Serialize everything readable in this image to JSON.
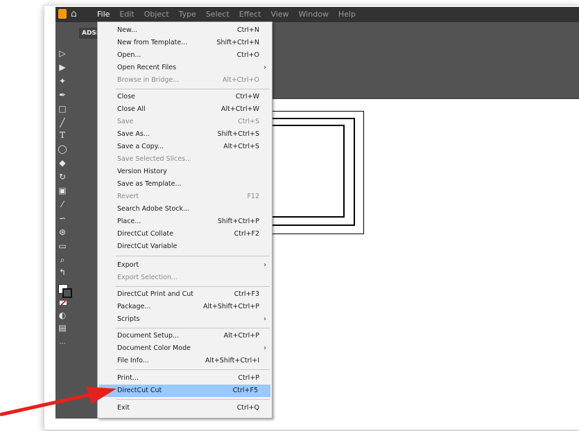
{
  "menubar": {
    "items": [
      "File",
      "Edit",
      "Object",
      "Type",
      "Select",
      "Effect",
      "View",
      "Window",
      "Help"
    ]
  },
  "document": {
    "tab_label": "ADSI T"
  },
  "file_menu": {
    "items": [
      {
        "label": "New...",
        "shortcut": "Ctrl+N",
        "disabled": false,
        "submenu": false
      },
      {
        "label": "New from Template...",
        "shortcut": "Shift+Ctrl+N",
        "disabled": false,
        "submenu": false
      },
      {
        "label": "Open...",
        "shortcut": "Ctrl+O",
        "disabled": false,
        "submenu": false
      },
      {
        "label": "Open Recent Files",
        "shortcut": "",
        "disabled": false,
        "submenu": true
      },
      {
        "label": "Browse in Bridge...",
        "shortcut": "Alt+Ctrl+O",
        "disabled": true,
        "submenu": false
      },
      {
        "label": "Close",
        "shortcut": "Ctrl+W",
        "disabled": false,
        "submenu": false
      },
      {
        "label": "Close All",
        "shortcut": "Alt+Ctrl+W",
        "disabled": false,
        "submenu": false
      },
      {
        "label": "Save",
        "shortcut": "Ctrl+S",
        "disabled": true,
        "submenu": false
      },
      {
        "label": "Save As...",
        "shortcut": "Shift+Ctrl+S",
        "disabled": false,
        "submenu": false
      },
      {
        "label": "Save a Copy...",
        "shortcut": "Alt+Ctrl+S",
        "disabled": false,
        "submenu": false
      },
      {
        "label": "Save Selected Slices...",
        "shortcut": "",
        "disabled": true,
        "submenu": false
      },
      {
        "label": "Version History",
        "shortcut": "",
        "disabled": false,
        "submenu": false
      },
      {
        "label": "Save as Template...",
        "shortcut": "",
        "disabled": false,
        "submenu": false
      },
      {
        "label": "Revert",
        "shortcut": "F12",
        "disabled": true,
        "submenu": false
      },
      {
        "label": "Search Adobe Stock...",
        "shortcut": "",
        "disabled": false,
        "submenu": false
      },
      {
        "label": "Place...",
        "shortcut": "Shift+Ctrl+P",
        "disabled": false,
        "submenu": false
      },
      {
        "label": "DirectCut Collate",
        "shortcut": "Ctrl+F2",
        "disabled": false,
        "submenu": false
      },
      {
        "label": "DirectCut Variable",
        "shortcut": "",
        "disabled": false,
        "submenu": false
      },
      {
        "label": "Export",
        "shortcut": "",
        "disabled": false,
        "submenu": true
      },
      {
        "label": "Export Selection...",
        "shortcut": "",
        "disabled": true,
        "submenu": false
      },
      {
        "label": "DirectCut Print and Cut",
        "shortcut": "Ctrl+F3",
        "disabled": false,
        "submenu": false
      },
      {
        "label": "Package...",
        "shortcut": "Alt+Shift+Ctrl+P",
        "disabled": false,
        "submenu": false
      },
      {
        "label": "Scripts",
        "shortcut": "",
        "disabled": false,
        "submenu": true
      },
      {
        "label": "Document Setup...",
        "shortcut": "Alt+Ctrl+P",
        "disabled": false,
        "submenu": false
      },
      {
        "label": "Document Color Mode",
        "shortcut": "",
        "disabled": false,
        "submenu": true
      },
      {
        "label": "File Info...",
        "shortcut": "Alt+Shift+Ctrl+I",
        "disabled": false,
        "submenu": false
      },
      {
        "label": "Print...",
        "shortcut": "Ctrl+P",
        "disabled": false,
        "submenu": false
      },
      {
        "label": "DirectCut Cut",
        "shortcut": "Ctrl+F5",
        "disabled": false,
        "submenu": false,
        "highlighted": true
      },
      {
        "label": "Exit",
        "shortcut": "Ctrl+Q",
        "disabled": false,
        "submenu": false
      }
    ]
  },
  "colors": {
    "highlight": "#99c9ff",
    "arrow": "#e8201b",
    "panel": "#535353",
    "menubar": "#323232"
  },
  "icons": {
    "submenu": "chevron-right-icon",
    "annotation": "red-arrow-icon"
  }
}
